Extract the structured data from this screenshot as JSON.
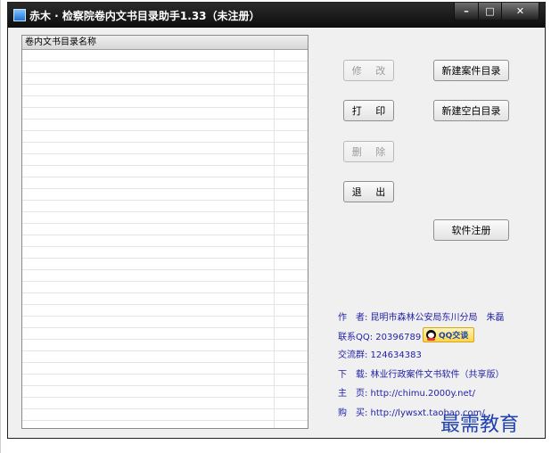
{
  "window": {
    "title": "赤木 · 检察院卷内文书目录助手1.33（未注册）",
    "controls": {
      "minimize": "–",
      "maximize": "□",
      "close": "✕"
    }
  },
  "list": {
    "column_header": "卷内文书目录名称"
  },
  "buttons": {
    "modify": "修 改",
    "print": "打 印",
    "delete": "删 除",
    "exit": "退 出",
    "new_case_dir": "新建案件目录",
    "new_blank_dir": "新建空白目录",
    "register": "软件注册"
  },
  "info": {
    "author": "作　者: 昆明市森林公安局东川分局　朱磊",
    "qq": "联系QQ: 20396789",
    "qq_button": "QQ交谈",
    "group": "交流群: 124634383",
    "download": "下　载: 林业行政案件文书软件（共享版）",
    "homepage": "主　页: http://chimu.2000y.net/",
    "buy": "购　买: http://lywsxt.taobao.com/"
  },
  "watermark": "最需教育",
  "colors": {
    "info_text": "#2323a8",
    "titlebar": "#1a1a1a"
  },
  "icons": {
    "app": "app-icon",
    "qq": "qq-penguin-icon"
  }
}
